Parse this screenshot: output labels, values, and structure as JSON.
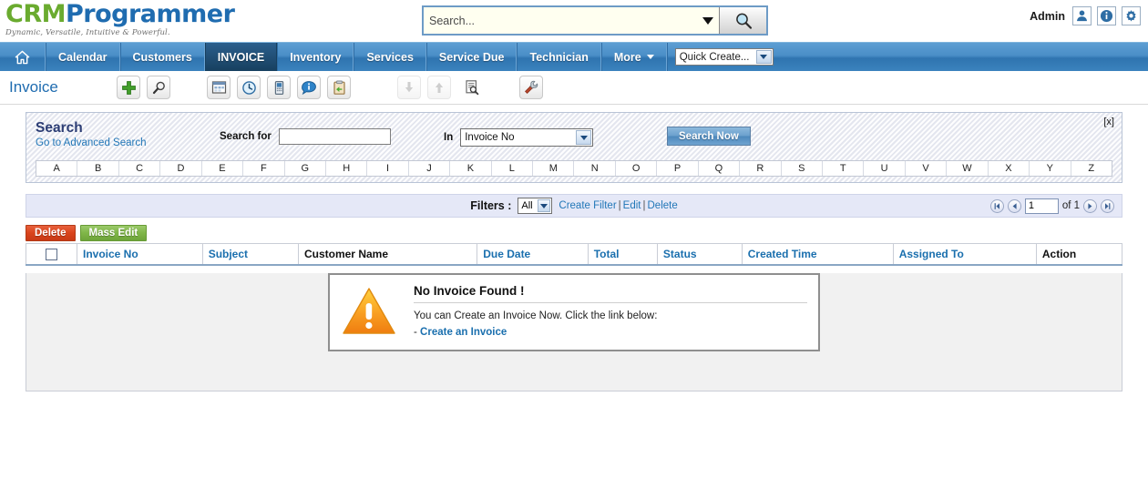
{
  "brand": {
    "name_part1": "CRM",
    "name_part2": "Programmer",
    "tagline": "Dynamic, Versatile, Intuitive & Powerful.",
    "color_green": "#6aab2f",
    "color_blue": "#1f6cb0"
  },
  "global_search": {
    "placeholder": "Search...",
    "value": "",
    "dropdown_icon": "chevron-down-icon",
    "button_icon": "search-icon"
  },
  "account": {
    "label": "Admin",
    "icons": [
      "user-icon",
      "info-icon",
      "gear-icon"
    ]
  },
  "nav": {
    "home_icon": "home-icon",
    "items": [
      {
        "label": "Calendar",
        "active": false
      },
      {
        "label": "Customers",
        "active": false
      },
      {
        "label": "INVOICE",
        "active": true
      },
      {
        "label": "Inventory",
        "active": false
      },
      {
        "label": "Services",
        "active": false
      },
      {
        "label": "Service Due",
        "active": false
      },
      {
        "label": "Technician",
        "active": false
      },
      {
        "label": "More",
        "active": false,
        "has_caret": true
      }
    ],
    "quick_create": "Quick Create..."
  },
  "toolbar": {
    "page_title": "Invoice",
    "icons": [
      "add-plus-icon",
      "magnifier-icon",
      "calendar-window-icon",
      "clock-icon",
      "device-icon",
      "comment-info-icon",
      "clipboard-import-icon",
      "download-arrow-icon",
      "upload-arrow-icon",
      "document-search-icon",
      "tools-settings-icon"
    ]
  },
  "search_panel": {
    "title": "Search",
    "advanced_link": "Go to Advanced Search",
    "search_for_label": "Search for",
    "search_for_value": "",
    "in_label": "In",
    "in_selected": "Invoice No",
    "search_now_label": "Search Now",
    "close_label": "[x]",
    "alphabet": [
      "A",
      "B",
      "C",
      "D",
      "E",
      "F",
      "G",
      "H",
      "I",
      "J",
      "K",
      "L",
      "M",
      "N",
      "O",
      "P",
      "Q",
      "R",
      "S",
      "T",
      "U",
      "V",
      "W",
      "X",
      "Y",
      "Z"
    ]
  },
  "filter_bar": {
    "label": "Filters :",
    "selected": "All",
    "create_filter": "Create Filter",
    "edit": "Edit",
    "delete": "Delete",
    "separator": "|"
  },
  "pagination": {
    "first_icon": "first-page-icon",
    "prev_icon": "prev-page-icon",
    "current_page": "1",
    "of_text": "of 1",
    "next_icon": "next-page-icon",
    "last_icon": "last-page-icon"
  },
  "actions": {
    "delete_label": "Delete",
    "mass_edit_label": "Mass Edit"
  },
  "table": {
    "columns": [
      {
        "label": "",
        "sortable": false,
        "is_checkbox": true
      },
      {
        "label": "Invoice No",
        "sortable": true
      },
      {
        "label": "Subject",
        "sortable": true
      },
      {
        "label": "Customer Name",
        "sortable": false
      },
      {
        "label": "Due Date",
        "sortable": true
      },
      {
        "label": "Total",
        "sortable": true
      },
      {
        "label": "Status",
        "sortable": true
      },
      {
        "label": "Created Time",
        "sortable": true
      },
      {
        "label": "Assigned To",
        "sortable": true
      },
      {
        "label": "Action",
        "sortable": false
      }
    ],
    "rows": []
  },
  "empty_state": {
    "icon": "warning-triangle-icon",
    "title": "No Invoice Found !",
    "body": "You can Create an Invoice Now. Click the link below:",
    "dash": "-",
    "link": "Create an Invoice"
  }
}
